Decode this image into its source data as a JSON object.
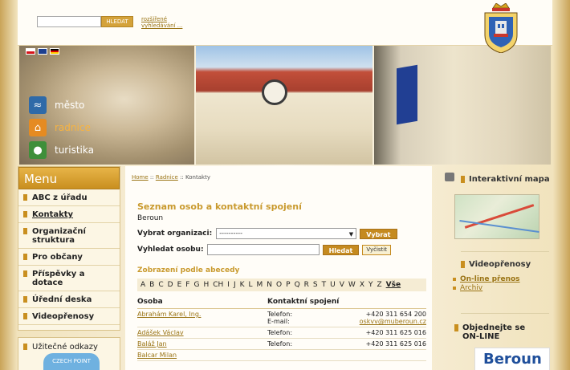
{
  "header": {
    "search_button": "HLEDAT",
    "advanced_search": "rozšířené vyhledávání ...",
    "crest_icon": "city-crest-icon"
  },
  "languages": [
    "cz",
    "en",
    "de"
  ],
  "hero_nav": [
    {
      "label": "město",
      "icon": "waves-icon"
    },
    {
      "label": "radnice",
      "icon": "townhall-icon"
    },
    {
      "label": "turistika",
      "icon": "footprint-icon"
    }
  ],
  "menu": {
    "title": "Menu",
    "items": [
      {
        "label": "ABC z úřadu"
      },
      {
        "label": "Kontakty"
      },
      {
        "label": "Organizační struktura"
      },
      {
        "label": "Pro občany"
      },
      {
        "label": "Příspěvky a dotace"
      },
      {
        "label": "Úřední deska"
      },
      {
        "label": "Videopřenosy"
      }
    ]
  },
  "useful_links": {
    "title": "Užitečné odkazy",
    "czechpoint": "CZECH POINT"
  },
  "breadcrumb": {
    "home": "Home",
    "sep": "::",
    "section": "Radnice",
    "current": "Kontakty"
  },
  "main": {
    "title": "Seznam osob a kontaktní spojení",
    "subtitle": "Beroun",
    "org_label": "Vybrat organizaci:",
    "org_value": "----------",
    "org_button": "Vybrat",
    "person_label": "Vyhledat osobu:",
    "person_placeholder": "",
    "find_button": "Hledat",
    "clear_button": "Vyčistit",
    "alpha_title": "Zobrazení podle abecedy",
    "alphabet": [
      "A",
      "B",
      "C",
      "D",
      "E",
      "F",
      "G",
      "H",
      "CH",
      "I",
      "J",
      "K",
      "L",
      "M",
      "N",
      "O",
      "P",
      "Q",
      "R",
      "S",
      "T",
      "U",
      "V",
      "W",
      "X",
      "Y",
      "Z"
    ],
    "alpha_all": "Vše",
    "table": {
      "headers": [
        "Osoba",
        "Kontaktní spojení"
      ],
      "rows": [
        {
          "name": "Abrahám Karel, Ing.",
          "label1": "Telefon:",
          "value1": "+420 311 654 200",
          "label2": "E-mail:",
          "value2": "oskvv@muberoun.cz"
        },
        {
          "name": "Adášek Václav",
          "label1": "Telefon:",
          "value1": "+420 311 625 016"
        },
        {
          "name": "Baláž Jan",
          "label1": "Telefon:",
          "value1": "+420 311 625 016"
        },
        {
          "name": "Balcar Milan"
        }
      ]
    }
  },
  "right": {
    "map_title": "Interaktivní mapa",
    "video_title": "Videopřenosy",
    "video_links": [
      "On-line přenos",
      "Archiv"
    ],
    "order_title": "Objednejte se ON-LINE",
    "logo_text": "Beroun"
  }
}
